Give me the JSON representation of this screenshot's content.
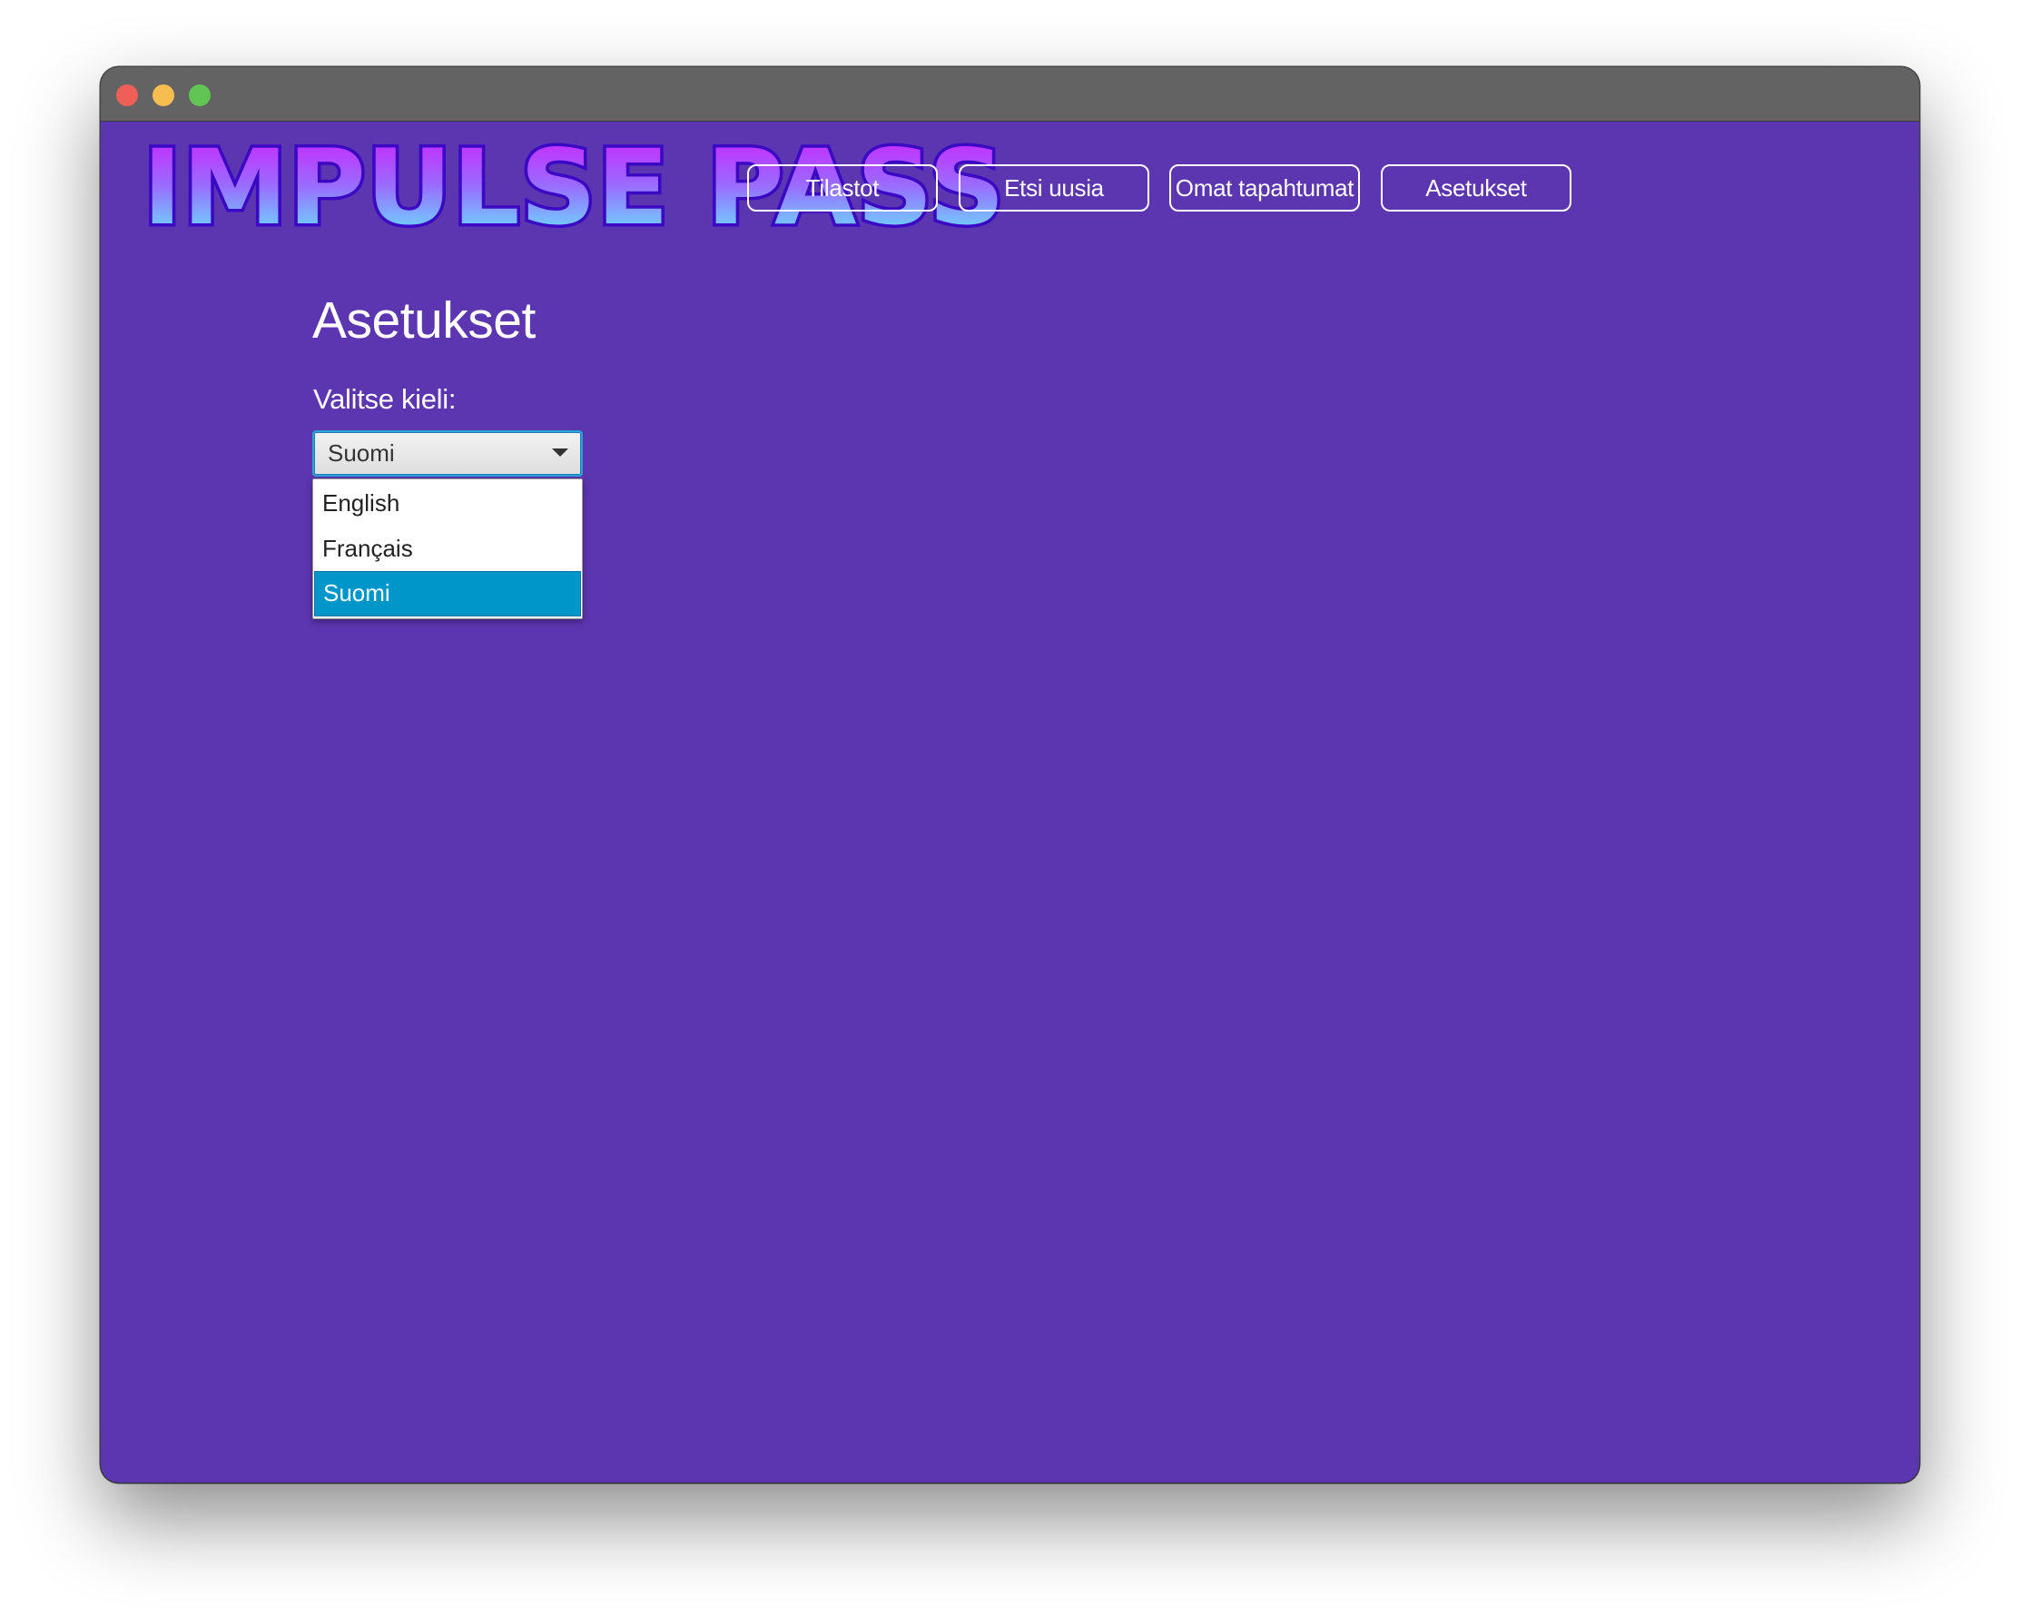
{
  "window": {
    "controls": [
      "close-dot",
      "minimize-dot",
      "zoom-dot"
    ]
  },
  "header": {
    "logo_text": "IMPULSE PASS",
    "nav": [
      {
        "label": "Tilastot"
      },
      {
        "label": "Etsi uusia"
      },
      {
        "label": "Omat tapahtumat"
      },
      {
        "label": "Asetukset"
      }
    ]
  },
  "settings": {
    "title": "Asetukset",
    "language_label": "Valitse kieli:",
    "language_select": {
      "value": "Suomi",
      "options": [
        "English",
        "Français",
        "Suomi"
      ],
      "highlighted": "Suomi"
    }
  },
  "colors": {
    "background": "#5c35b0",
    "titlebar": "#636363",
    "selection": "#0096c9",
    "logo_top": "#d11bff",
    "logo_bottom": "#5ff8ff"
  }
}
